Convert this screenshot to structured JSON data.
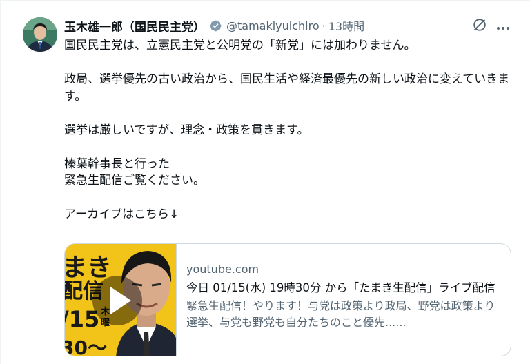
{
  "author": {
    "display_name": "玉木雄一郎（国民民主党）",
    "handle": "@tamakiyuichiro",
    "separator": "·",
    "timestamp": "13時間",
    "verified_color": "#829aab"
  },
  "icons": {
    "avatar": "profile-photo",
    "verified": "verified-badge-icon",
    "grok": "grok-icon",
    "more": "more-dots-icon",
    "play": "play-icon"
  },
  "tweet": {
    "lines": [
      "国民民主党は、立憲民主党と公明党の「新党」には加わりません。",
      "",
      "政局、選挙優先の古い政治から、国民生活や経済最優先の新しい政治に変えていきます。",
      "",
      "選挙は厳しいですが、理念・政策を貫きます。",
      "",
      "榛葉幹事長と行った",
      "緊急生配信ご覧ください。",
      "",
      "アーカイブはこちら↓"
    ]
  },
  "link_card": {
    "domain": "youtube.com",
    "title": "今日 01/15(水) 19時30分 から「たまき生配信」ライブ配信",
    "description": "緊急生配信！やります！与党は政策より政局、野党は政策より選挙、与党も野党も自分たちのこと優先......",
    "thumbnail_text": {
      "line1": "まき",
      "line2": "配信",
      "line3": "/15",
      "line4": "30〜",
      "day1": "木",
      "day2": "曜"
    },
    "thumbnail_colors": {
      "background": "#f2c318",
      "text": "#1a1a1a"
    }
  }
}
